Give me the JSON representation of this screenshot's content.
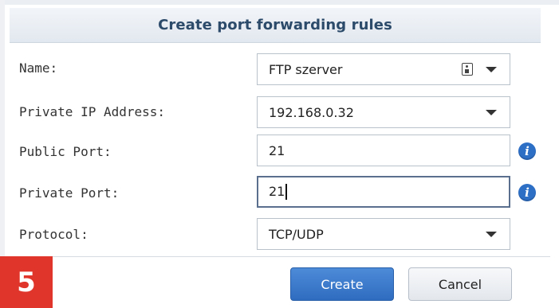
{
  "dialog": {
    "title": "Create port forwarding rules"
  },
  "form": {
    "name": {
      "label": "Name:",
      "value": "FTP szerver"
    },
    "private_ip": {
      "label": "Private IP Address:",
      "value": "192.168.0.32"
    },
    "public_port": {
      "label": "Public Port:",
      "value": "21"
    },
    "private_port": {
      "label": "Private Port:",
      "value": "21"
    },
    "protocol": {
      "label": "Protocol:",
      "value": "TCP/UDP"
    }
  },
  "buttons": {
    "create_label": "Create",
    "cancel_label": "Cancel"
  },
  "step_badge": "5",
  "colors": {
    "accent": "#2f6cc0",
    "badge": "#e0352b",
    "title": "#2c4a6a"
  },
  "icons": {
    "name_field_icon": "contact-card-icon",
    "info": "info-icon",
    "dropdown": "chevron-down-icon"
  }
}
